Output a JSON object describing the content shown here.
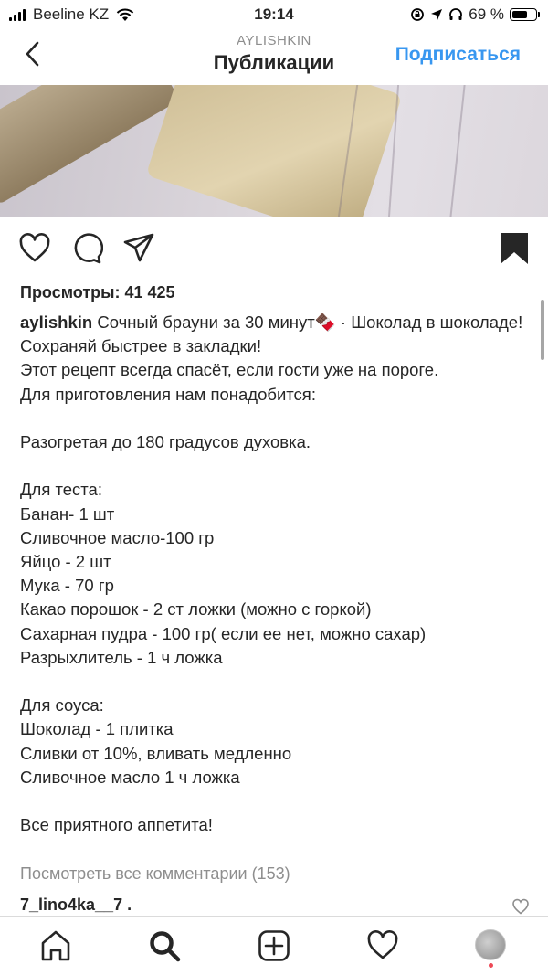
{
  "status_bar": {
    "carrier": "Beeline KZ",
    "time": "19:14",
    "battery_percent_text": "69 %",
    "battery_level": 0.69
  },
  "header": {
    "subtitle": "AYLISHKIN",
    "title": "Публикации",
    "follow_label": "Подписаться"
  },
  "post": {
    "views_text": "Просмотры: 41 425",
    "username": "aylishkin",
    "caption": " Сочный брауни за 30 минут🍫 · Шоколад в шоколаде!\nСохраняй быстрее в закладки!\nЭтот рецепт всегда спасёт, если гости уже на пороге.\nДля приготовления нам понадобится:\n\nРазогретая до 180 градусов духовка.\n\nДля теста:\nБанан- 1 шт\nСливочное масло-100 гр\nЯйцо - 2 шт\nМука - 70 гр\nКакао порошок - 2 ст ложки (можно с горкой)\nСахарная пудра - 100 гр( если ее нет, можно сахар)\nРазрыхлитель - 1 ч ложка\n\nДля соуса:\nШоколад - 1 плитка\nСливки от 10%, вливать медленно\nСливочное масло 1 ч ложка\n\nВсе приятного аппетита!",
    "view_comments": "Посмотреть все комментарии (153)",
    "first_comment_user": "7_lino4ka__7 ."
  },
  "colors": {
    "accent": "#3897f0",
    "text": "#262626",
    "muted": "#8e8e8e",
    "notification": "#ed4956"
  },
  "icons": {
    "back": "chevron-left-icon",
    "reels": "reels-icon",
    "mute": "sound-off-icon",
    "like": "heart-icon",
    "comment": "comment-icon",
    "share": "send-icon",
    "save": "bookmark-filled-icon",
    "tab_home": "home-icon",
    "tab_search": "search-icon",
    "tab_new": "add-post-icon",
    "tab_activity": "heart-icon"
  }
}
